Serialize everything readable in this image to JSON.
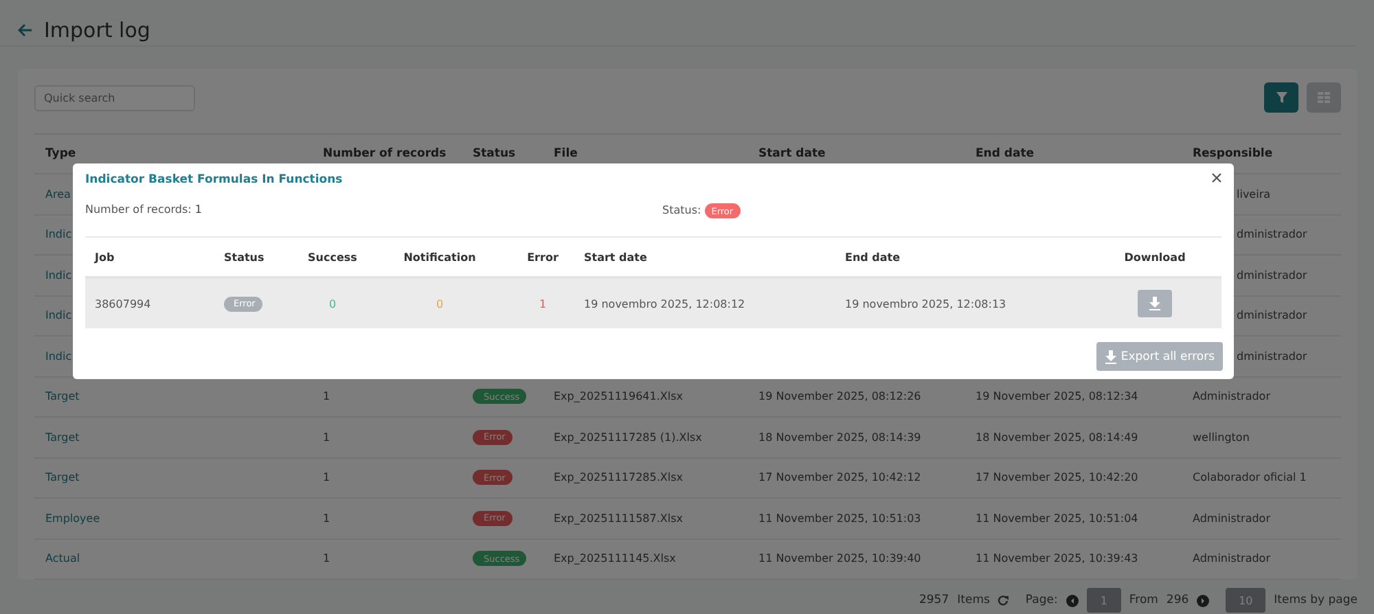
{
  "page": {
    "title": "Import log"
  },
  "search": {
    "placeholder": "Quick search"
  },
  "table": {
    "columns": [
      "Type",
      "Number of records",
      "Status",
      "File",
      "Start date",
      "End date",
      "Responsible"
    ],
    "rows": [
      {
        "kind": "covered",
        "type": "Area",
        "responsible": "liveira"
      },
      {
        "kind": "covered",
        "type": "Indic",
        "responsible": "dministrador"
      },
      {
        "kind": "covered",
        "type": "Indic",
        "responsible": "dministrador"
      },
      {
        "kind": "covered",
        "type": "Indic",
        "responsible": "dministrador"
      },
      {
        "kind": "covered",
        "type": "Indic",
        "responsible": "dministrador"
      },
      {
        "kind": "full",
        "type": "Target",
        "records": "1",
        "status": {
          "label": "Success",
          "kind": "success"
        },
        "file": "Exp_20251119641.Xlsx",
        "start": "19 November 2025, 08:12:26",
        "end": "19 November 2025, 08:12:34",
        "responsible": "Administrador"
      },
      {
        "kind": "full",
        "type": "Target",
        "records": "1",
        "status": {
          "label": "Error",
          "kind": "error"
        },
        "file": "Exp_20251117285 (1).Xlsx",
        "start": "18 November 2025, 08:14:39",
        "end": "18 November 2025, 08:14:49",
        "responsible": "wellington"
      },
      {
        "kind": "full",
        "type": "Target",
        "records": "1",
        "status": {
          "label": "Error",
          "kind": "error"
        },
        "file": "Exp_20251117285.Xlsx",
        "start": "17 November 2025, 10:42:12",
        "end": "17 November 2025, 10:42:20",
        "responsible": "Colaborador oficial 1"
      },
      {
        "kind": "full",
        "type": "Employee",
        "records": "1",
        "status": {
          "label": "Error",
          "kind": "error"
        },
        "file": "Exp_20251111587.Xlsx",
        "start": "11 November 2025, 10:51:03",
        "end": "11 November 2025, 10:51:04",
        "responsible": "Administrador"
      },
      {
        "kind": "full",
        "type": "Actual",
        "records": "1",
        "status": {
          "label": "Success",
          "kind": "success"
        },
        "file": "Exp_2025111145.Xlsx",
        "start": "11 November 2025, 10:39:40",
        "end": "11 November 2025, 10:39:43",
        "responsible": "Administrador"
      }
    ]
  },
  "pagination": {
    "total": "2957",
    "items_label": "Items",
    "page_label": "Page:",
    "page": "1",
    "from_label": "From",
    "pages": "296",
    "per_page": "10",
    "per_page_label": "Items by page"
  },
  "modal": {
    "title": "Indicator Basket Formulas In Functions",
    "records_label": "Number of records:",
    "records": "1",
    "status_label": "Status:",
    "status": {
      "label": "Error",
      "kind": "error_bright"
    },
    "columns": [
      "Job",
      "Status",
      "Success",
      "Notification",
      "Error",
      "Start date",
      "End date",
      "Download"
    ],
    "rows": [
      {
        "job": "38607994",
        "status": {
          "label": "Error",
          "kind": "muted"
        },
        "success": "0",
        "notification": "0",
        "error": "1",
        "start": "19 novembro 2025, 12:08:12",
        "end": "19 novembro 2025, 12:08:13"
      }
    ],
    "export_button": "Export all errors"
  }
}
